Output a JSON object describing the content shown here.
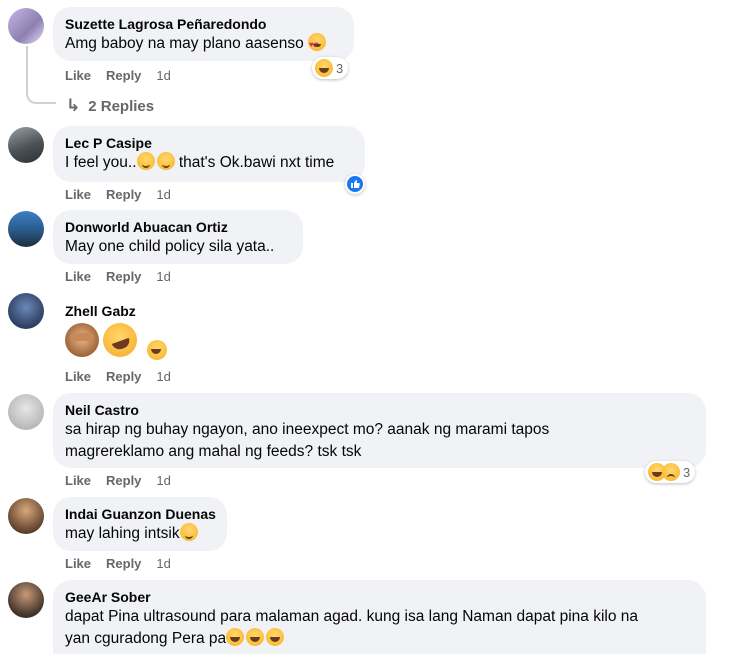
{
  "colors": {
    "bubble": "#f0f2f5",
    "action_text": "#65676b",
    "like_blue": "#1877f2"
  },
  "comments": [
    {
      "name": "Suzette Lagrosa Peñaredondo",
      "text": "Amg baboy na may plano aasenso",
      "like": "Like",
      "reply": "Reply",
      "time": "1d",
      "reaction_count": "3",
      "reactions": [
        "laugh-emoji"
      ]
    },
    {
      "name": "Lec P Casipe",
      "text": "I feel you..",
      "text2": "that's Ok.bawi nxt time",
      "like": "Like",
      "reply": "Reply",
      "time": "1d",
      "reactions": [
        "like"
      ]
    },
    {
      "name": "Donworld Abuacan Ortiz",
      "text": "May one child policy sila yata..",
      "like": "Like",
      "reply": "Reply",
      "time": "1d"
    },
    {
      "name": "Zhell Gabz",
      "like": "Like",
      "reply": "Reply",
      "time": "1d",
      "emojis": [
        "see-no-evil-monkey",
        "rolling-laugh",
        "laugh-emoji"
      ]
    },
    {
      "name": "Neil Castro",
      "text": "sa hirap ng buhay ngayon, ano ineexpect mo? aanak ng marami tapos",
      "text_line2": "magrereklamo ang mahal ng feeds? tsk tsk",
      "like": "Like",
      "reply": "Reply",
      "time": "1d",
      "reaction_count": "3",
      "reactions": [
        "laugh-emoji",
        "sad-emoji"
      ]
    },
    {
      "name": "Indai Guanzon Duenas",
      "text": "may lahing intsik",
      "like": "Like",
      "reply": "Reply",
      "time": "1d"
    },
    {
      "name": "GeeAr Sober",
      "text": "dapat Pina ultrasound para malaman agad. kung isa lang Naman dapat pina kilo na",
      "text_line2": "yan cguradong Pera pa"
    }
  ],
  "thread": {
    "replies_label": "2 Replies"
  }
}
